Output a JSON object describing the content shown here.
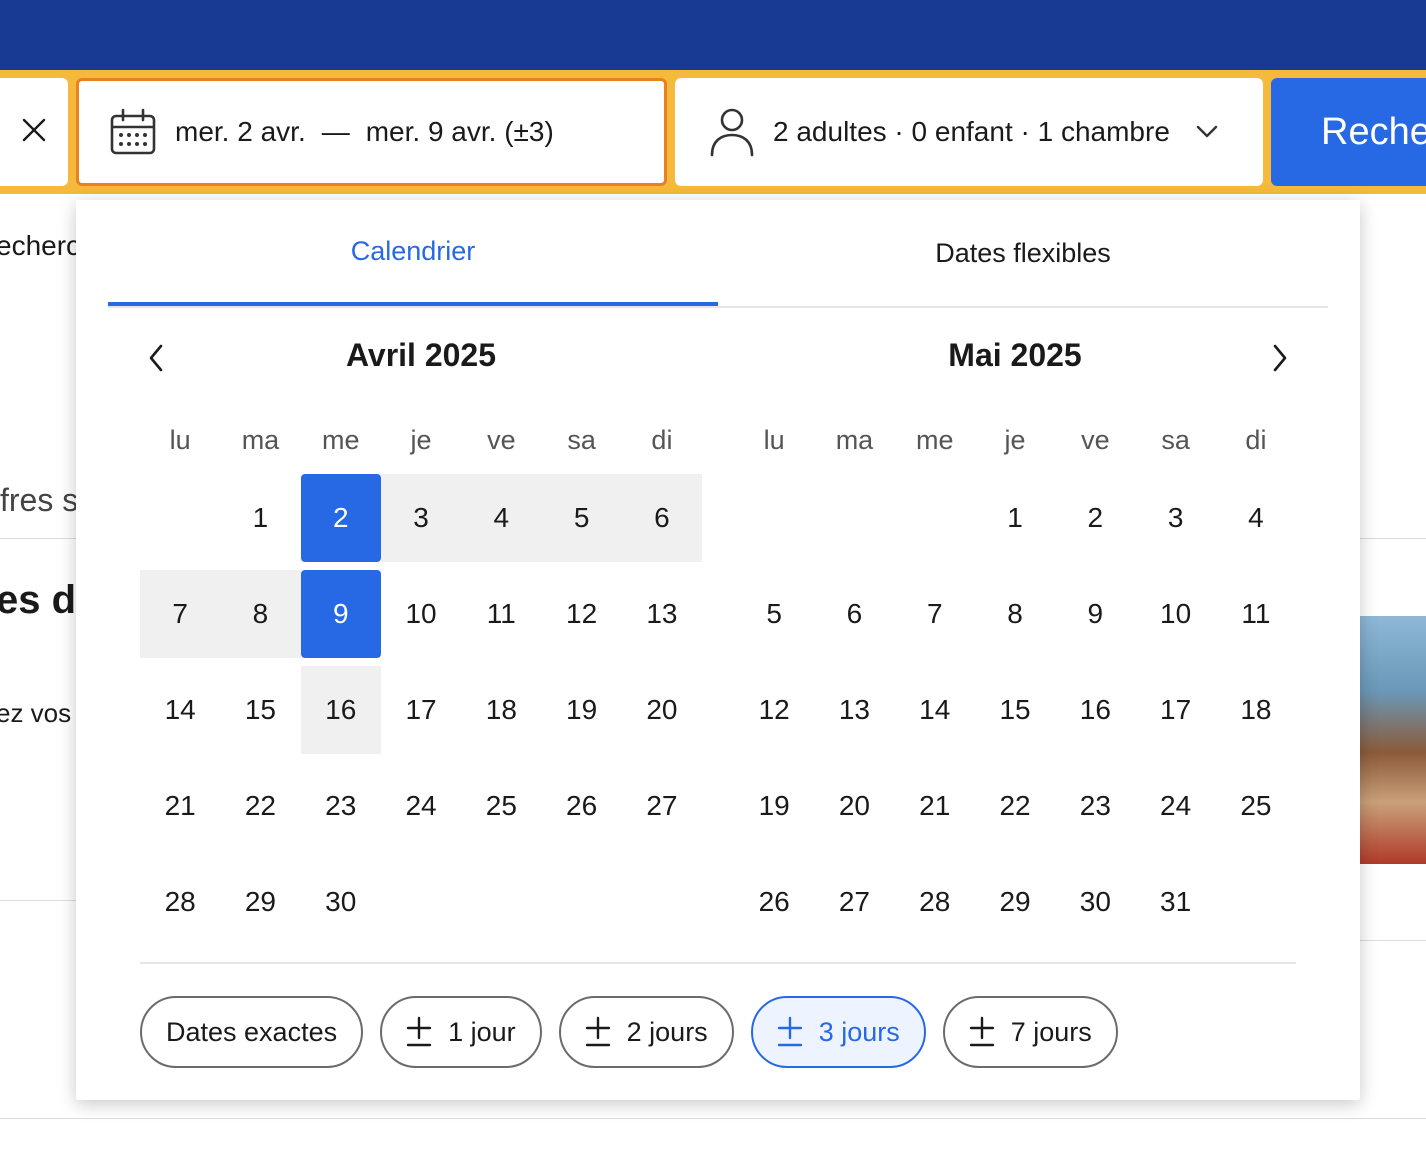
{
  "search": {
    "dates_from": "mer. 2 avr.",
    "dates_dash": "—",
    "dates_to": "mer. 9 avr. (±3)",
    "guests": "2 adultes · 0 enfant · 1 chambre",
    "search_button": "Reche"
  },
  "background": {
    "frag1": "echerc",
    "frag2": "fres s",
    "frag3": "es de",
    "frag4": "ez vos"
  },
  "tabs": {
    "calendar": "Calendrier",
    "flexible": "Dates flexibles"
  },
  "weekdays": [
    "lu",
    "ma",
    "me",
    "je",
    "ve",
    "sa",
    "di"
  ],
  "months": [
    {
      "title": "Avril 2025",
      "offset": 1,
      "days": [
        "1",
        "2",
        "3",
        "4",
        "5",
        "6",
        "7",
        "8",
        "9",
        "10",
        "11",
        "12",
        "13",
        "14",
        "15",
        "16",
        "17",
        "18",
        "19",
        "20",
        "21",
        "22",
        "23",
        "24",
        "25",
        "26",
        "27",
        "28",
        "29",
        "30"
      ],
      "selected": [
        "2",
        "9"
      ],
      "range": [
        "3",
        "4",
        "5",
        "6",
        "7",
        "8",
        "16"
      ]
    },
    {
      "title": "Mai 2025",
      "offset": 3,
      "days": [
        "1",
        "2",
        "3",
        "4",
        "5",
        "6",
        "7",
        "8",
        "9",
        "10",
        "11",
        "12",
        "13",
        "14",
        "15",
        "16",
        "17",
        "18",
        "19",
        "20",
        "21",
        "22",
        "23",
        "24",
        "25",
        "26",
        "27",
        "28",
        "29",
        "30",
        "31"
      ],
      "selected": [],
      "range": []
    }
  ],
  "flex_options": [
    {
      "label": "Dates exactes",
      "plusminus": false,
      "active": false
    },
    {
      "label": "1 jour",
      "plusminus": true,
      "active": false
    },
    {
      "label": "2 jours",
      "plusminus": true,
      "active": false
    },
    {
      "label": "3 jours",
      "plusminus": true,
      "active": true
    },
    {
      "label": "7 jours",
      "plusminus": true,
      "active": false
    }
  ],
  "colors": {
    "brand_dark": "#183a93",
    "search_frame": "#f5b93b",
    "accent": "#2769e4",
    "active_border": "#e8821e",
    "range_fill": "#f0f0f0"
  },
  "icons": [
    "close-icon",
    "calendar-icon",
    "person-icon",
    "chevron-down-icon",
    "chevron-left-icon",
    "chevron-right-icon",
    "plus-minus-icon"
  ]
}
